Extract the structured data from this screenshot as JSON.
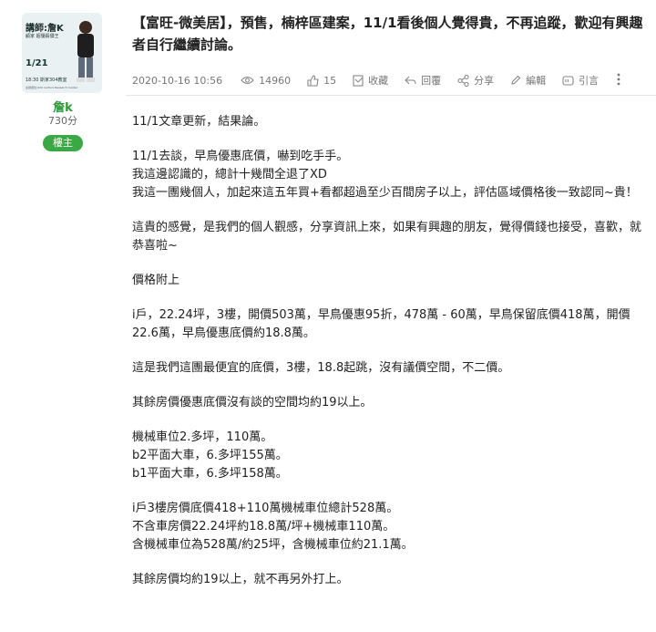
{
  "author": {
    "avatar": {
      "title": "講師:詹K",
      "subtitle": "顧家 超優殺價王",
      "date": "1/21",
      "time": "18:30 斯家304教室",
      "footer": "主辦單位:XXX Lecture Research Center"
    },
    "name": "詹k",
    "points": "730分",
    "badge": "樓主"
  },
  "post": {
    "title": "【富旺-微美居】，預售，楠梓區建案，11/1看後個人覺得貴，不再追蹤，歡迎有興趣者自行繼續討論。",
    "date": "2020-10-16 10:56",
    "views": "14960",
    "likes": "15",
    "actions": {
      "save": "收藏",
      "reply": "回覆",
      "share": "分享",
      "edit": "編輯",
      "quote": "引言"
    }
  },
  "body": {
    "p1": [
      "11/1文章更新，結果論。"
    ],
    "p2": [
      "11/1去談，早鳥優惠底價，嚇到吃手手。",
      "我這邊認識的，總計十幾間全退了XD",
      "我這一團幾個人，加起來這五年買+看都超過至少百間房子以上，評估區域價格後一致認同~貴！"
    ],
    "p3": [
      "這貴的感覺，是我們的個人觀感，分享資訊上來，如果有興趣的朋友，覺得價錢也接受，喜歡，就恭喜啦~"
    ],
    "p4": [
      "價格附上"
    ],
    "p5": [
      "i戶，22.24坪，3樓，開價503萬，早鳥優惠95折，478萬 - 60萬，早鳥保留底價418萬，開價22.6萬，早鳥優惠底價約18.8萬。"
    ],
    "p6": [
      "這是我們這團最便宜的底價，3樓，18.8起跳，沒有議價空間，不二價。"
    ],
    "p7": [
      "其餘房價優惠底價沒有談的空間均約19以上。"
    ],
    "p8": [
      "機械車位2.多坪，110萬。",
      "b2平面大車，6.多坪155萬。",
      "b1平面大車，6.多坪158萬。"
    ],
    "p9": [
      "i戶3樓房價底價418+110萬機械車位總計528萬。",
      "不含車房價22.24坪約18.8萬/坪+機械車110萬。",
      "含機械車位為528萬/約25坪，含機械車位約21.1萬。"
    ],
    "p10": [
      "其餘房價均約19以上，就不再另外打上。"
    ]
  },
  "colors": {
    "accent": "#39a845",
    "username": "#2e9a3a",
    "meta": "#777777"
  }
}
